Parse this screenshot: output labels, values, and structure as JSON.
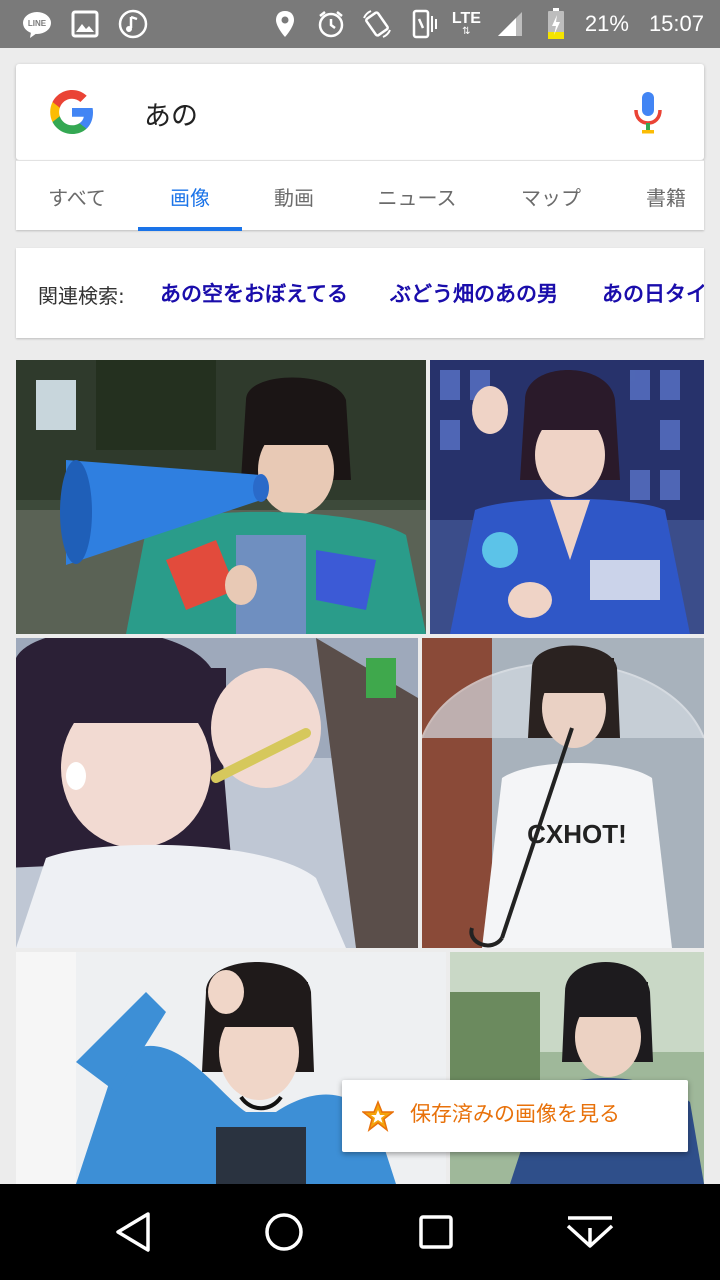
{
  "status_bar": {
    "icons_left": [
      "line-icon",
      "gallery-icon",
      "music-icon"
    ],
    "icons_right": [
      "location-icon",
      "alarm-icon",
      "rotate-icon",
      "vibrate-icon"
    ],
    "network": "LTE",
    "battery": "21%",
    "time": "15:07"
  },
  "search": {
    "query": "あの"
  },
  "tabs": [
    {
      "label": "すべて",
      "active": false
    },
    {
      "label": "画像",
      "active": true
    },
    {
      "label": "動画",
      "active": false
    },
    {
      "label": "ニュース",
      "active": false
    },
    {
      "label": "マップ",
      "active": false
    },
    {
      "label": "書籍",
      "active": false
    }
  ],
  "related": {
    "label": "関連検索:",
    "items": [
      "あの空をおぼえてる",
      "ぶどう畑のあの男",
      "あの日タイ"
    ]
  },
  "images": [
    {
      "alt": "girl-with-blue-megaphone"
    },
    {
      "alt": "girl-in-blue-jersey"
    },
    {
      "alt": "girl-eating-snack"
    },
    {
      "alt": "girl-with-umbrella"
    },
    {
      "alt": "girl-in-blue-jacket"
    },
    {
      "alt": "girl-outdoors"
    }
  ],
  "saved_images": {
    "label": "保存済みの画像を見る",
    "icon": "star-icon"
  },
  "nav": {
    "buttons": [
      "back-icon",
      "home-icon",
      "recents-icon",
      "keyboard-hide-icon"
    ]
  },
  "colors": {
    "accent": "#1a73e8",
    "link": "#1a0dab",
    "saved": "#e8710a"
  }
}
